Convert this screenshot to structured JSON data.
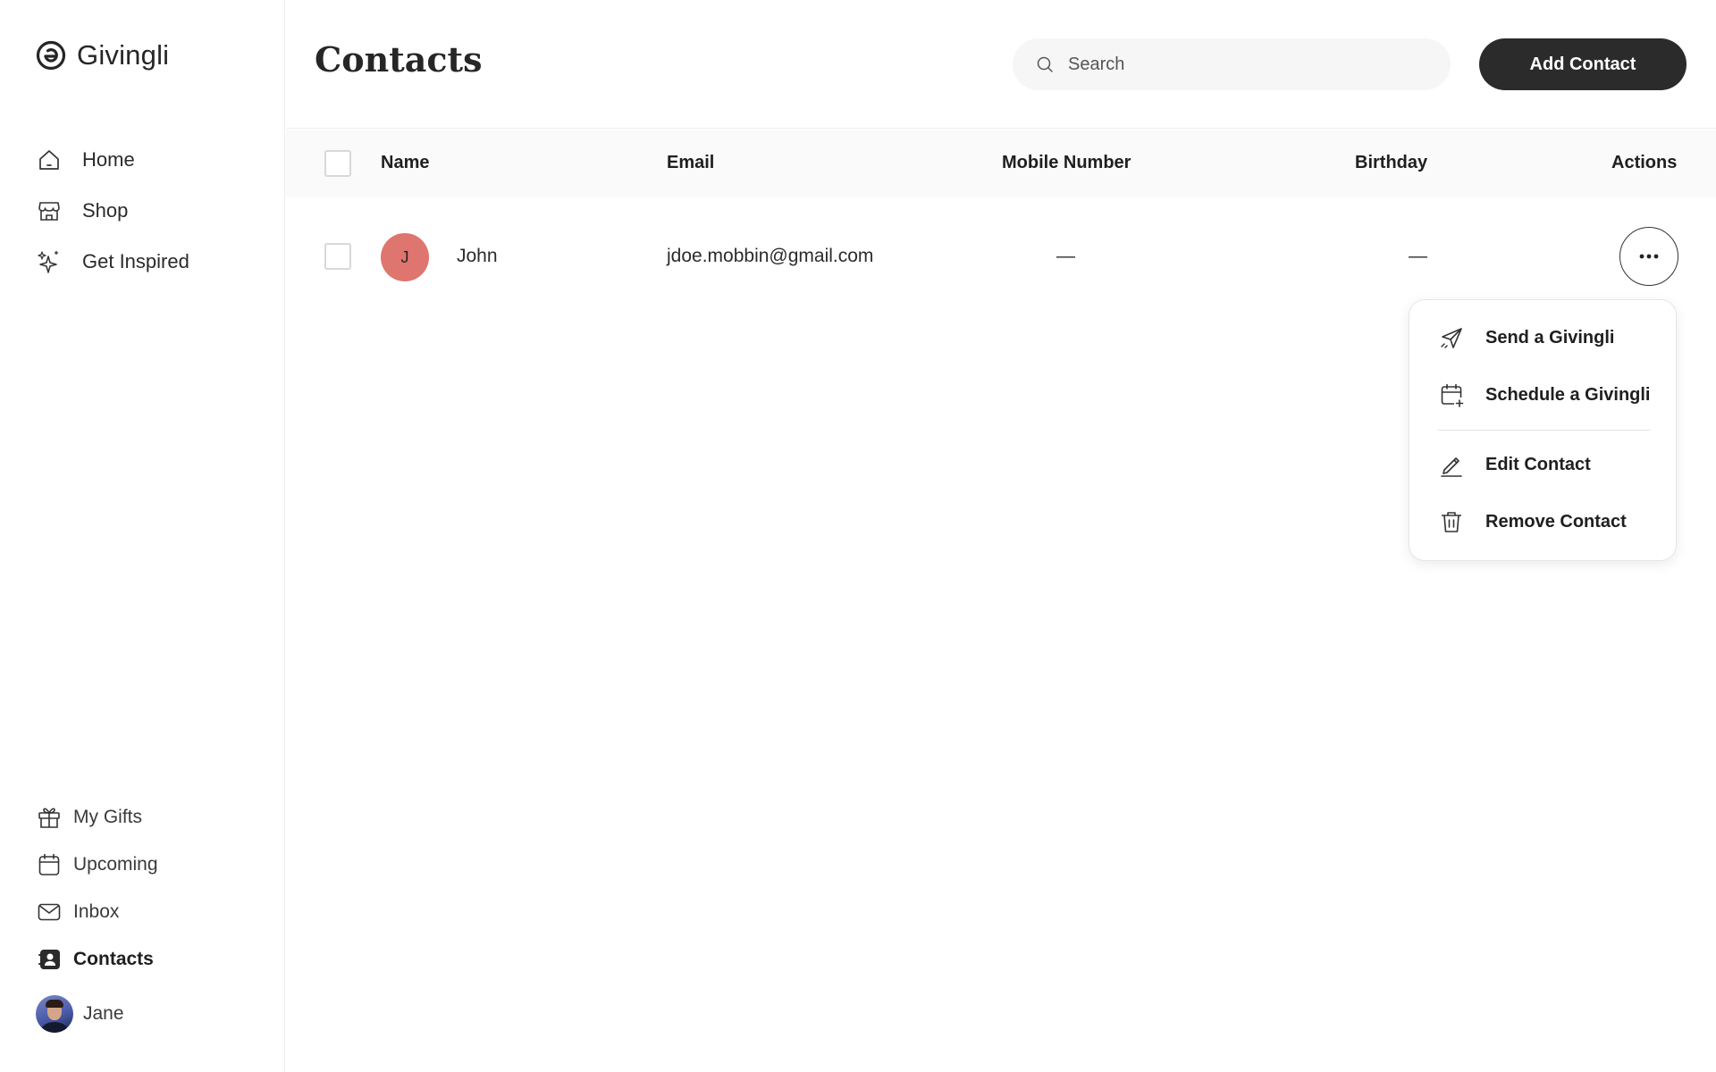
{
  "brand": {
    "name": "Givingli"
  },
  "sidebar": {
    "top_items": [
      {
        "label": "Home",
        "icon": "home-icon"
      },
      {
        "label": "Shop",
        "icon": "shop-icon"
      },
      {
        "label": "Get Inspired",
        "icon": "sparkle-icon"
      }
    ],
    "bottom_items": [
      {
        "label": "My Gifts",
        "icon": "gift-icon"
      },
      {
        "label": "Upcoming",
        "icon": "calendar-icon"
      },
      {
        "label": "Inbox",
        "icon": "mail-icon"
      },
      {
        "label": "Contacts",
        "icon": "contacts-icon",
        "active": true
      }
    ],
    "user": {
      "name": "Jane"
    }
  },
  "header": {
    "title": "Contacts",
    "search_placeholder": "Search",
    "add_button": "Add Contact"
  },
  "table": {
    "columns": [
      "Name",
      "Email",
      "Mobile Number",
      "Birthday",
      "Actions"
    ],
    "rows": [
      {
        "initial": "J",
        "name": "John",
        "email": "jdoe.mobbin@gmail.com",
        "mobile": "—",
        "birthday": "—",
        "avatar_color": "#df756f"
      }
    ]
  },
  "actions_menu": {
    "items": [
      {
        "label": "Send a Givingli",
        "icon": "send-icon"
      },
      {
        "label": "Schedule a Givingli",
        "icon": "calendar-add-icon"
      },
      {
        "label": "Edit Contact",
        "icon": "edit-icon"
      },
      {
        "label": "Remove Contact",
        "icon": "trash-icon"
      }
    ]
  },
  "colors": {
    "primary_button": "#2b2b2b",
    "avatar": "#df756f",
    "search_bg": "#f6f6f6",
    "table_header_bg": "#fafafa"
  }
}
